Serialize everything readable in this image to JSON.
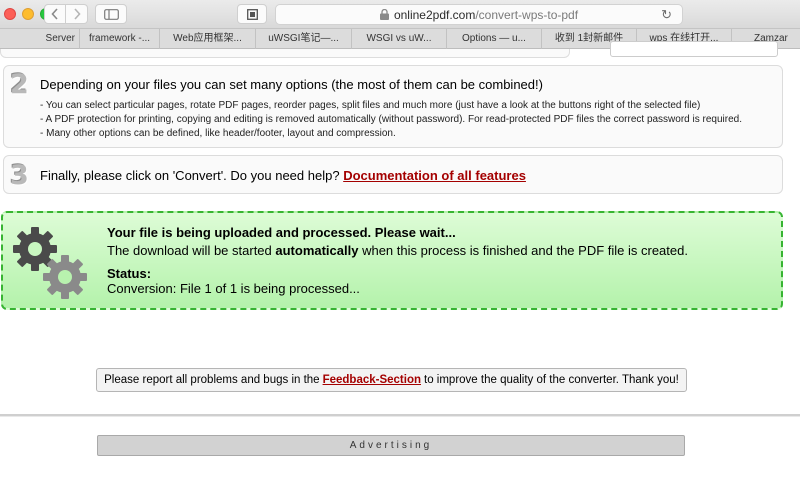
{
  "browser": {
    "url_host": "online2pdf.com",
    "url_path": "/convert-wps-to-pdf",
    "bookmarks": [
      "Server",
      "framework -...",
      "Web应用框架...",
      "uWSGI笔记—...",
      "WSGI vs uW...",
      "Options — u...",
      "收到 1封新邮件",
      "wps 在线打开...",
      "Zamzar"
    ]
  },
  "step2": {
    "number": "2",
    "title": "Depending on your files you can set many options (the most of them can be combined!)",
    "bullets": [
      "- You can select particular pages, rotate PDF pages, reorder pages, split files and much more (just have a look at the buttons right of the selected file)",
      "- A PDF protection for printing, copying and editing is removed automatically (without password). For read-protected PDF files the correct password is required.",
      "- Many other options can be defined, like header/footer, layout and compression."
    ]
  },
  "step3": {
    "number": "3",
    "text": "Finally, please click on 'Convert'. Do you need help?",
    "link": "Documentation of all features"
  },
  "processing": {
    "title": "Your file is being uploaded and processed. Please wait...",
    "line_pre": "The download will be started ",
    "line_bold": "automatically",
    "line_post": " when this process is finished and the PDF file is created.",
    "status_label": "Status:",
    "status_text": "Conversion: File 1 of 1 is being processed..."
  },
  "report": {
    "pre": "Please report all problems and bugs in the",
    "link": "Feedback-Section",
    "post": "to improve the quality of the converter. Thank you!"
  },
  "advertising": "Advertising",
  "colors": {
    "link": "#a40000",
    "success_bg": "#c8f7c0",
    "success_border": "#37b432"
  }
}
